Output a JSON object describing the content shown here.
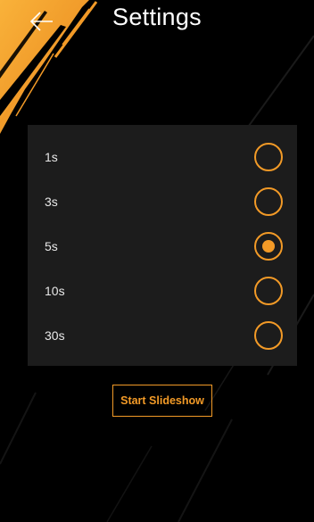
{
  "header": {
    "title": "Settings",
    "back_icon": "arrow-left-icon"
  },
  "interval_options": [
    {
      "label": "1s",
      "selected": false
    },
    {
      "label": "3s",
      "selected": false
    },
    {
      "label": "5s",
      "selected": true
    },
    {
      "label": "10s",
      "selected": false
    },
    {
      "label": "30s",
      "selected": false
    }
  ],
  "actions": {
    "start_label": "Start Slideshow"
  },
  "colors": {
    "accent": "#f29a27",
    "background": "#000000",
    "panel": "#1c1c1c"
  }
}
